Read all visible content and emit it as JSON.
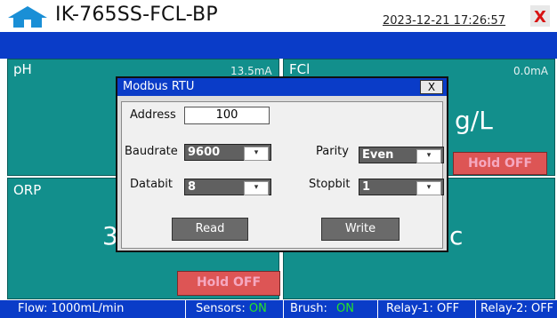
{
  "header": {
    "title": "IK-765SS-FCL-BP",
    "datetime": "2023-12-21 17:26:57",
    "close_glyph": "X"
  },
  "panels": {
    "ph": {
      "label": "pH",
      "current": "13.5mA"
    },
    "fcl": {
      "label": "FCl",
      "current": "0.0mA",
      "unit_fragment": "g/L",
      "hold": "Hold OFF"
    },
    "orp": {
      "label": "ORP",
      "value_fragment": "3",
      "hold": "Hold OFF"
    },
    "fourth": {
      "value_fragment": "c"
    }
  },
  "status": {
    "flow": "Flow:  1000mL/min",
    "sensors_label": "Sensors:",
    "sensors_value": "ON",
    "brush_label": "Brush:",
    "brush_value": "ON",
    "relay1": "Relay-1: OFF",
    "relay2": "Relay-2: OFF"
  },
  "dialog": {
    "title": "Modbus RTU",
    "close": "X",
    "address_label": "Address",
    "address_value": "100",
    "baudrate_label": "Baudrate",
    "baudrate_value": "9600",
    "parity_label": "Parity",
    "parity_value": "Even",
    "databit_label": "Databit",
    "databit_value": "8",
    "stopbit_label": "Stopbit",
    "stopbit_value": "1",
    "dropdown_arrow": "▾",
    "read_label": "Read",
    "write_label": "Write"
  },
  "colors": {
    "band_blue": "#0a3cc8",
    "panel_teal": "#128f8c",
    "on_green": "#27e427",
    "hold_pink": "#f5a8c0"
  }
}
